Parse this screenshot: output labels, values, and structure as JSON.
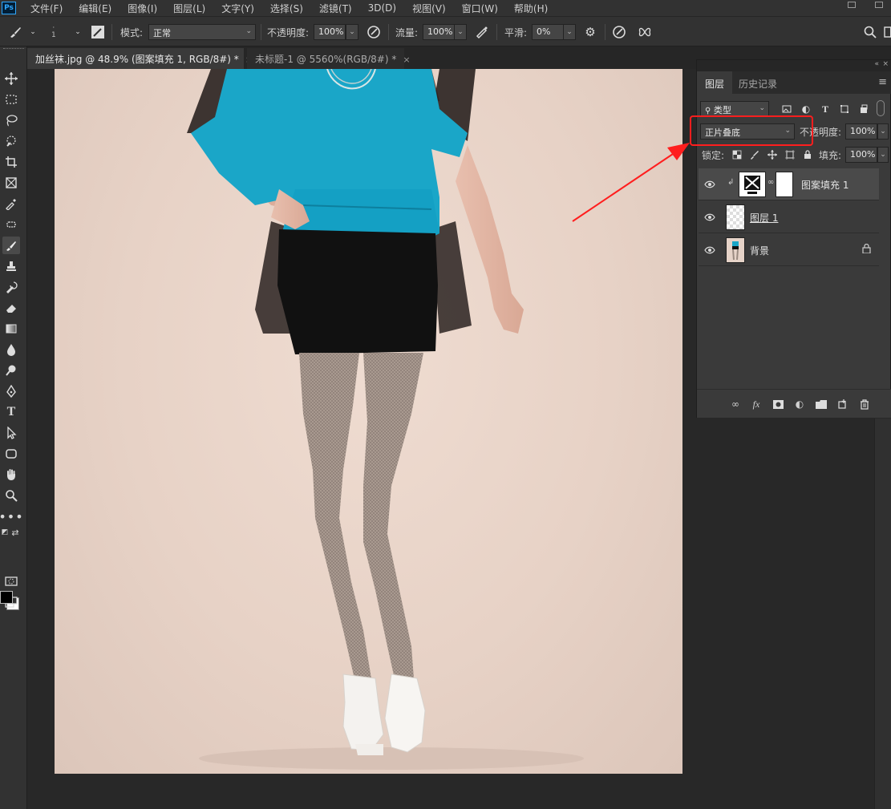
{
  "menu": {
    "items": [
      "文件(F)",
      "编辑(E)",
      "图像(I)",
      "图层(L)",
      "文字(Y)",
      "选择(S)",
      "滤镜(T)",
      "3D(D)",
      "视图(V)",
      "窗口(W)",
      "帮助(H)"
    ]
  },
  "options": {
    "brush_size": "1",
    "mode_label": "模式:",
    "mode_value": "正常",
    "opacity_label": "不透明度:",
    "opacity_value": "100%",
    "flow_label": "流量:",
    "flow_value": "100%",
    "smoothing_label": "平滑:",
    "smoothing_value": "0%"
  },
  "tabs": [
    {
      "label": "加丝袜.jpg @ 48.9% (图案填充 1, RGB/8#) *",
      "close": "×"
    },
    {
      "label": "未标题-1 @ 5560%(RGB/8#) *",
      "close": "×"
    }
  ],
  "layers_panel": {
    "tabs": [
      "图层",
      "历史记录"
    ],
    "filter_label": "类型",
    "blend_mode": "正片叠底",
    "opacity_label": "不透明度:",
    "opacity_value": "100%",
    "lock_label": "锁定:",
    "fill_label": "填充:",
    "fill_value": "100%",
    "layers": [
      {
        "name": "图案填充 1",
        "selected": true
      },
      {
        "name": "图层 1",
        "selected": false
      },
      {
        "name": "背景",
        "selected": false,
        "locked": true
      }
    ]
  },
  "colors": {
    "accent_red": "#ff1e1e",
    "foreground": "#000000",
    "background": "#ffffff",
    "shirt": "#1aa6c8"
  }
}
